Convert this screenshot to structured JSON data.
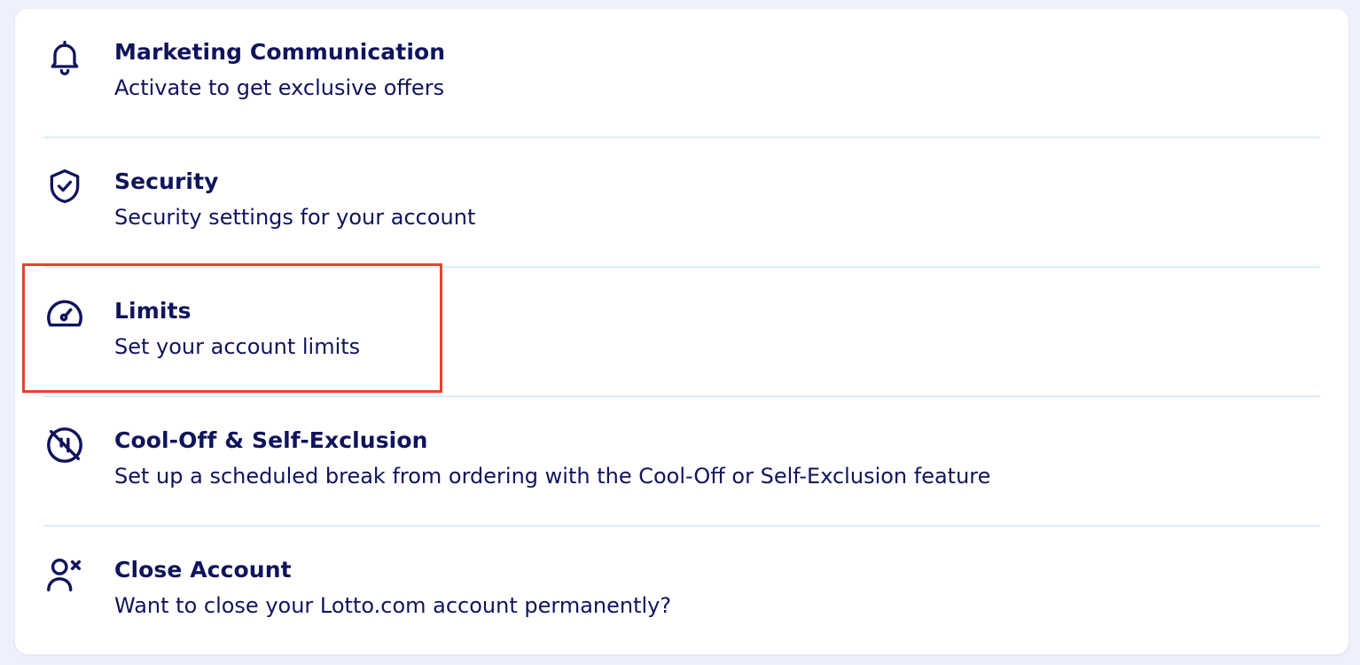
{
  "colors": {
    "text": "#10145c",
    "divider": "#d7eef8",
    "highlight": "#e8432b",
    "background": "#eef0fb"
  },
  "settings": {
    "items": [
      {
        "icon": "bell-icon",
        "title": "Marketing Communication",
        "description": "Activate to get exclusive offers"
      },
      {
        "icon": "shield-check-icon",
        "title": "Security",
        "description": "Security settings for your account"
      },
      {
        "icon": "gauge-icon",
        "title": "Limits",
        "description": "Set your account limits"
      },
      {
        "icon": "pause-slash-icon",
        "title": "Cool-Off & Self-Exclusion",
        "description": "Set up a scheduled break from ordering with the Cool-Off or Self-Exclusion feature"
      },
      {
        "icon": "user-remove-icon",
        "title": "Close Account",
        "description": "Want to close your Lotto.com account permanently?"
      }
    ]
  }
}
